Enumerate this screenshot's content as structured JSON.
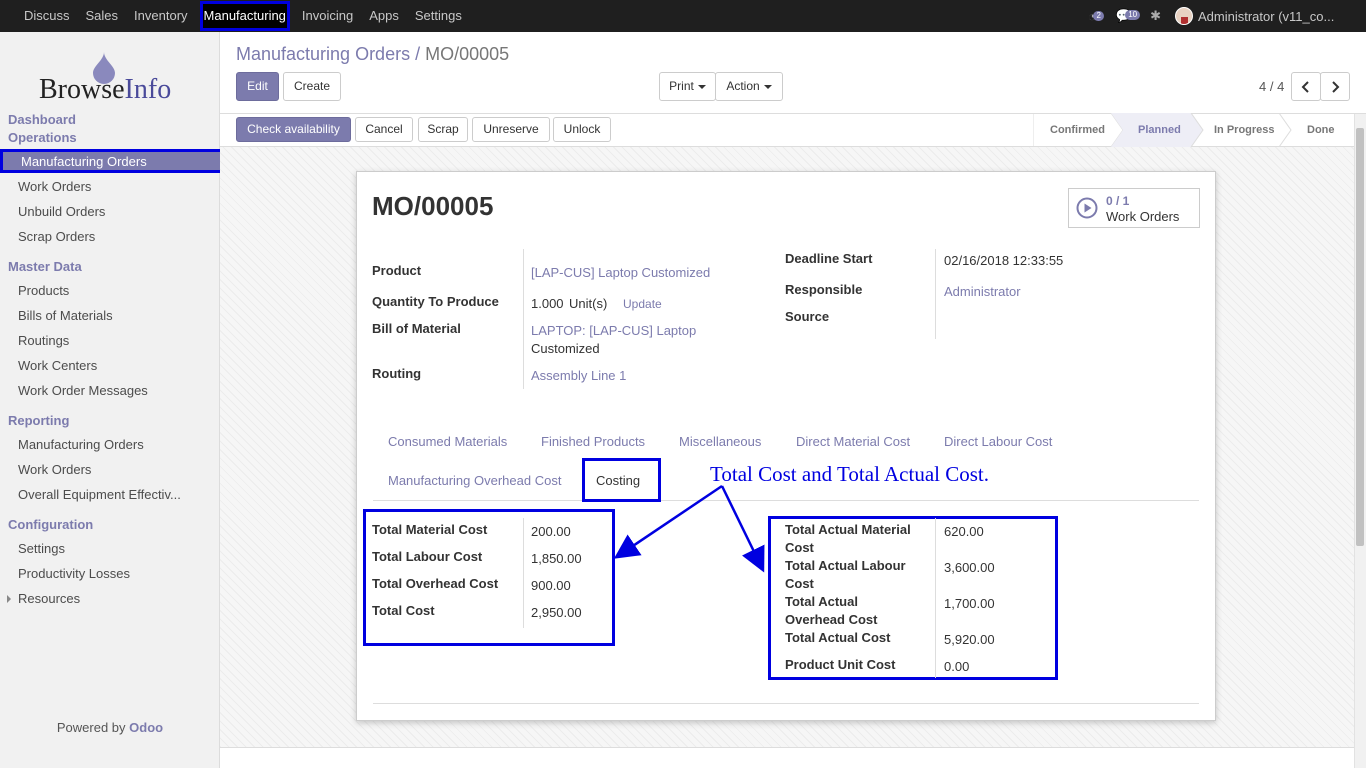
{
  "topbar": {
    "menu": [
      "Discuss",
      "Sales",
      "Inventory",
      "Manufacturing",
      "Invoicing",
      "Apps",
      "Settings"
    ],
    "active": "Manufacturing",
    "activity_count": "2",
    "message_count": "10",
    "user": "Administrator (v11_co..."
  },
  "sidebar": {
    "logo_text": "BrowseInfo",
    "sections": {
      "dashboard": "Dashboard",
      "operations": "Operations",
      "master_data": "Master Data",
      "reporting": "Reporting",
      "configuration": "Configuration"
    },
    "operations_items": [
      "Manufacturing Orders",
      "Work Orders",
      "Unbuild Orders",
      "Scrap Orders"
    ],
    "master_data_items": [
      "Products",
      "Bills of Materials",
      "Routings",
      "Work Centers",
      "Work Order Messages"
    ],
    "reporting_items": [
      "Manufacturing Orders",
      "Work Orders",
      "Overall Equipment Effectiv..."
    ],
    "configuration_items": [
      "Settings",
      "Productivity Losses",
      "Resources"
    ],
    "powered_by": "Powered by",
    "powered_brand": "Odoo"
  },
  "control_panel": {
    "breadcrumb_parent": "Manufacturing Orders",
    "breadcrumb_sep": "/",
    "breadcrumb_current": "MO/00005",
    "edit": "Edit",
    "create": "Create",
    "print": "Print",
    "action": "Action",
    "pager": "4 / 4"
  },
  "header_buttons": [
    "Check availability",
    "Cancel",
    "Scrap",
    "Unreserve",
    "Unlock"
  ],
  "stages": [
    "Confirmed",
    "Planned",
    "In Progress",
    "Done"
  ],
  "current_stage": "Planned",
  "form": {
    "title": "MO/00005",
    "smart_button": {
      "count": "0 / 1",
      "label": "Work Orders"
    },
    "product_label": "Product",
    "product": "[LAP-CUS] Laptop Customized",
    "qty_label": "Quantity To Produce",
    "qty": "1.000",
    "uom": "Unit(s)",
    "update": "Update",
    "bom_label": "Bill of Material",
    "bom_line1": "LAPTOP: [LAP-CUS] Laptop",
    "bom_line2": "Customized",
    "routing_label": "Routing",
    "routing": "Assembly Line 1",
    "deadline_label": "Deadline Start",
    "deadline": "02/16/2018 12:33:55",
    "responsible_label": "Responsible",
    "responsible": "Administrator",
    "source_label": "Source",
    "source": ""
  },
  "tabs": [
    "Consumed Materials",
    "Finished Products",
    "Miscellaneous",
    "Direct Material Cost",
    "Direct Labour Cost",
    "Manufacturing Overhead Cost",
    "Costing"
  ],
  "active_tab": "Costing",
  "costing": {
    "total_material_cost_label": "Total Material Cost",
    "total_material_cost": "200.00",
    "total_labour_cost_label": "Total Labour Cost",
    "total_labour_cost": "1,850.00",
    "total_overhead_cost_label": "Total Overhead Cost",
    "total_overhead_cost": "900.00",
    "total_cost_label": "Total Cost",
    "total_cost": "2,950.00",
    "actual_material_l1": "Total Actual Material",
    "actual_material_l2": "Cost",
    "actual_material": "620.00",
    "actual_labour_l1": "Total Actual Labour",
    "actual_labour_l2": "Cost",
    "actual_labour": "3,600.00",
    "actual_overhead_l1": "Total Actual",
    "actual_overhead_l2": "Overhead Cost",
    "actual_overhead": "1,700.00",
    "actual_total_label": "Total Actual Cost",
    "actual_total": "5,920.00",
    "unit_cost_label": "Product Unit Cost",
    "unit_cost": "0.00"
  },
  "annotation": "Total Cost and Total Actual Cost.",
  "colors": {
    "brand": "#7c7bad",
    "annotation": "#0000e0",
    "topbar": "#1f1f1f"
  }
}
